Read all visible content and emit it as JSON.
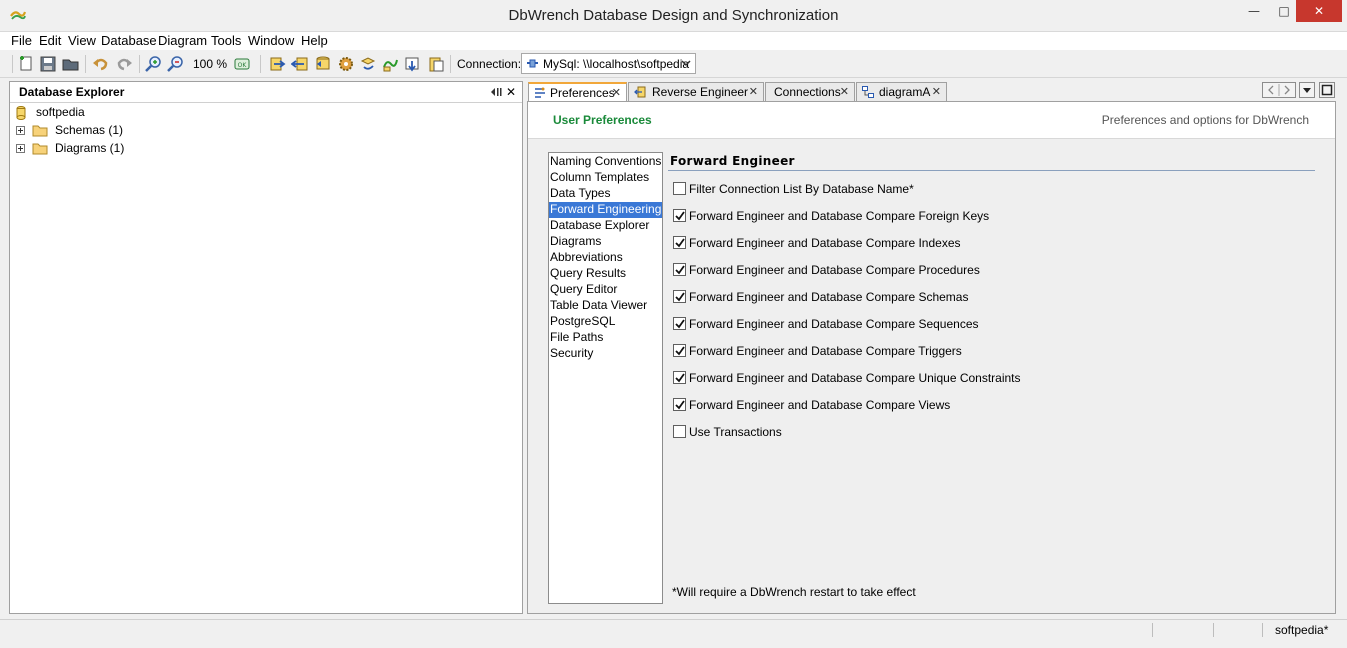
{
  "window": {
    "title": "DbWrench Database Design and Synchronization",
    "controls": {
      "minimize": "—",
      "maximize": "□",
      "close": "✕"
    }
  },
  "menu": [
    "File",
    "Edit",
    "View",
    "Database",
    "Diagram",
    "Tools",
    "Window",
    "Help"
  ],
  "toolbar": {
    "zoom": "100 %",
    "connection_label": "Connection:",
    "connection_value": "MySql: \\\\localhost\\softpedia"
  },
  "explorer": {
    "title": "Database Explorer",
    "root": "softpedia",
    "children": [
      "Schemas (1)",
      "Diagrams (1)"
    ]
  },
  "tabs": [
    "Preferences",
    "Reverse Engineer",
    "Connections",
    "diagramA"
  ],
  "prefs": {
    "header": "User Preferences",
    "subheader": "Preferences and options for DbWrench",
    "categories": [
      "Naming Conventions",
      "Column Templates",
      "Data Types",
      "Forward Engineering",
      "Database Explorer",
      "Diagrams",
      "Abbreviations",
      "Query Results",
      "Query Editor",
      "Table Data Viewer",
      "PostgreSQL",
      "File Paths",
      "Security"
    ],
    "selected_category": "Forward Engineering",
    "section_title": "Forward Engineer",
    "options": [
      {
        "label": "Filter Connection List By Database Name*",
        "checked": false
      },
      {
        "label": "Forward Engineer and Database Compare Foreign Keys",
        "checked": true
      },
      {
        "label": "Forward Engineer and Database Compare Indexes",
        "checked": true
      },
      {
        "label": "Forward Engineer and Database Compare Procedures",
        "checked": true
      },
      {
        "label": "Forward Engineer and Database Compare Schemas",
        "checked": true
      },
      {
        "label": "Forward Engineer and Database Compare Sequences",
        "checked": true
      },
      {
        "label": "Forward Engineer and Database Compare Triggers",
        "checked": true
      },
      {
        "label": "Forward Engineer and Database Compare Unique Constraints",
        "checked": true
      },
      {
        "label": "Forward Engineer and Database Compare Views",
        "checked": true
      },
      {
        "label": "Use Transactions",
        "checked": false
      }
    ],
    "note": "*Will require a DbWrench restart to take effect"
  },
  "status": {
    "project": "softpedia*"
  },
  "colors": {
    "accent_green": "#1a8a3a",
    "selection_blue": "#3a78d6",
    "close_red": "#c7372d",
    "tab_highlight": "#f1a73a"
  }
}
